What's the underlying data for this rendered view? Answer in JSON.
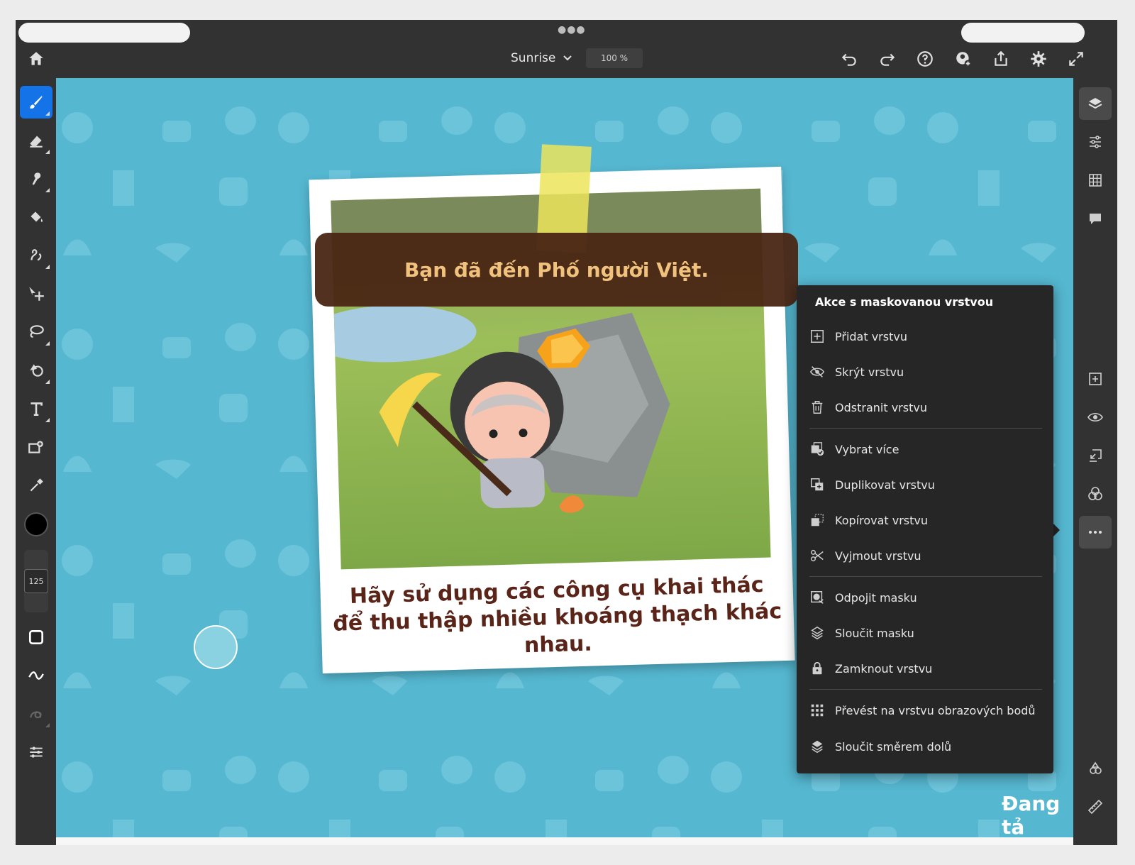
{
  "topbar": {
    "document_title": "Sunrise",
    "zoom": "100 %",
    "icons": [
      "home-icon",
      "undo-icon",
      "redo-icon",
      "help-icon",
      "invite-icon",
      "share-icon",
      "settings-icon",
      "fullscreen-icon"
    ]
  },
  "left_tools": {
    "items": [
      "brush-icon",
      "eraser-icon",
      "smudge-icon",
      "fill-icon",
      "clone-stamp-icon",
      "move-icon",
      "lasso-icon",
      "shape-icon",
      "type-icon",
      "place-image-icon",
      "eyedropper-icon"
    ],
    "brush_size": "125",
    "current_color": "#000000"
  },
  "right_tools": {
    "items": [
      "layers-icon",
      "properties-icon",
      "grid-icon",
      "comments-icon",
      "add-layer-icon",
      "visibility-icon",
      "import-icon",
      "blend-icon",
      "more-icon",
      "libraries-icon",
      "ruler-icon"
    ]
  },
  "canvas": {
    "banner_text": "Bạn đã đến Phố người Việt.",
    "caption_text": "Hãy sử dụng các công cụ khai thác để thu thập nhiều khoáng thạch khác nhau.",
    "loading_text": "Đang tả"
  },
  "menu": {
    "title": "Akce s maskovanou vrstvou",
    "items": [
      {
        "label": "Přidat vrstvu",
        "icon": "add-layer-icon"
      },
      {
        "label": "Skrýt vrstvu",
        "icon": "hide-icon"
      },
      {
        "label": "Odstranit vrstvu",
        "icon": "trash-icon"
      },
      {
        "label": "Vybrat více",
        "icon": "select-multiple-icon"
      },
      {
        "label": "Duplikovat vrstvu",
        "icon": "duplicate-icon"
      },
      {
        "label": "Kopírovat vrstvu",
        "icon": "copy-icon"
      },
      {
        "label": "Vyjmout vrstvu",
        "icon": "cut-icon"
      },
      {
        "label": "Odpojit masku",
        "icon": "unlink-mask-icon"
      },
      {
        "label": "Sloučit masku",
        "icon": "merge-mask-icon"
      },
      {
        "label": "Zamknout vrstvu",
        "icon": "lock-icon"
      },
      {
        "label": "Převést na vrstvu obrazových bodů",
        "icon": "rasterize-icon"
      },
      {
        "label": "Sloučit směrem dolů",
        "icon": "merge-down-icon"
      }
    ]
  },
  "colors": {
    "app_bg": "#323232",
    "accent": "#1473e6",
    "canvas_bg": "#55b7d0",
    "menu_bg": "#262626"
  }
}
